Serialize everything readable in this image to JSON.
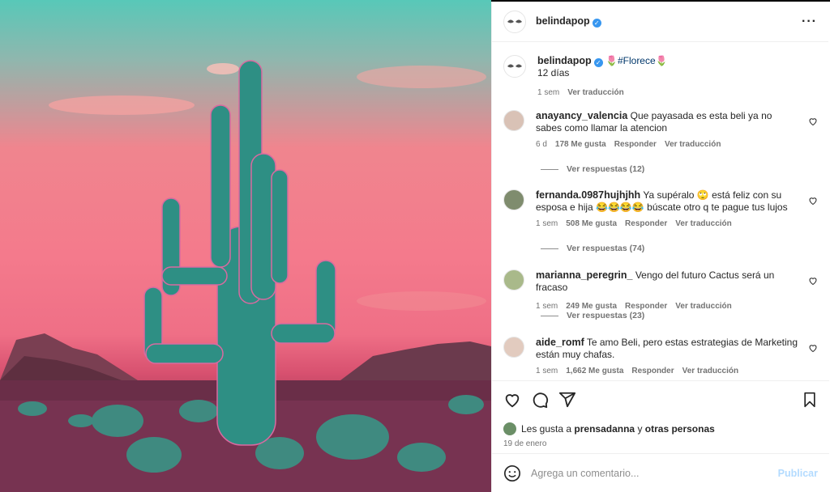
{
  "post": {
    "author": "belindapop",
    "caption": {
      "hashtag": "#Florece",
      "text_line2": "12 días",
      "time": "1 sem",
      "translate": "Ver traducción"
    },
    "more_icon": "more-horizontal-icon"
  },
  "comments": [
    {
      "username": "anayancy_valencia",
      "text": "Que payasada es esta beli ya no sabes como llamar la atencion",
      "time": "6 d",
      "likes": "178 Me gusta",
      "reply": "Responder",
      "translate": "Ver traducción",
      "replies": "Ver respuestas (12)"
    },
    {
      "username": "fernanda.0987hujhjhh",
      "text": "Ya supéralo 🙄 está feliz con su esposa e hija 😂😂😂😂 búscate otro q te pague tus lujos",
      "time": "1 sem",
      "likes": "508 Me gusta",
      "reply": "Responder",
      "translate": "Ver traducción",
      "replies": "Ver respuestas (74)"
    },
    {
      "username": "marianna_peregrin_",
      "text": "Vengo del futuro Cactus será un fracaso",
      "time": "1 sem",
      "likes": "249 Me gusta",
      "reply": "Responder",
      "translate": "Ver traducción",
      "replies": "Ver respuestas (23)"
    },
    {
      "username": "aide_romf",
      "text": "Te amo Beli, pero estas estrategias de Marketing están muy chafas.",
      "time": "1 sem",
      "likes": "1,662 Me gusta",
      "reply": "Responder",
      "translate": "Ver traducción"
    }
  ],
  "actions": {
    "likes_prefix": "Les gusta a",
    "likes_user": "prensadanna",
    "likes_and": "y",
    "likes_others": "otras personas",
    "date": "19 de enero"
  },
  "add_comment": {
    "placeholder": "Agrega un comentario...",
    "publish": "Publicar"
  },
  "colors": {
    "verified": "#3897f0",
    "hashtag": "#00376b",
    "publish_disabled": "#b3dbff"
  }
}
